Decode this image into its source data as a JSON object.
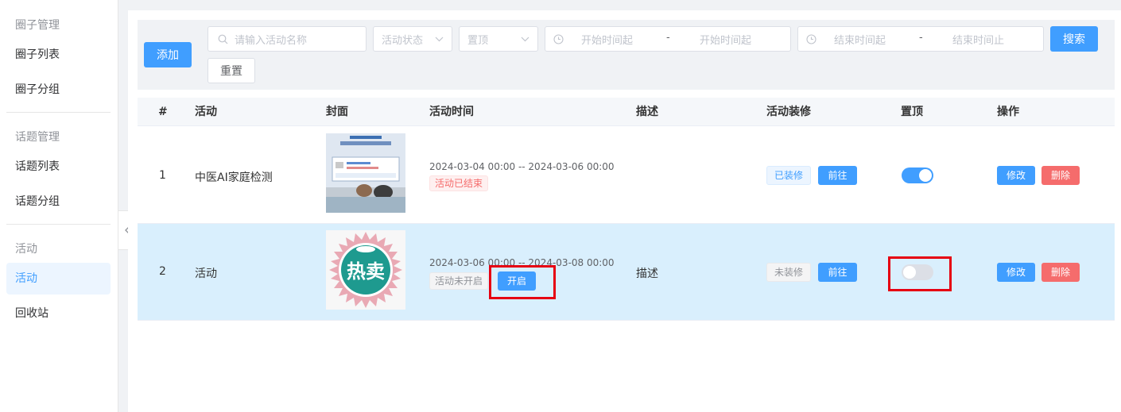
{
  "sidebar": {
    "groups": [
      {
        "title": "圈子管理",
        "items": [
          {
            "label": "圈子列表"
          },
          {
            "label": "圈子分组"
          }
        ]
      },
      {
        "title": "话题管理",
        "items": [
          {
            "label": "话题列表"
          },
          {
            "label": "话题分组"
          }
        ]
      },
      {
        "title": "活动",
        "items": [
          {
            "label": "活动",
            "active": true
          },
          {
            "label": "回收站"
          }
        ]
      }
    ]
  },
  "toolbar": {
    "add_label": "添加",
    "search_placeholder": "请输入活动名称",
    "status_placeholder": "活动状态",
    "pin_placeholder": "置顶",
    "start_range": {
      "from": "开始时间起",
      "sep": "-",
      "to": "开始时间起"
    },
    "end_range": {
      "from": "结束时间起",
      "sep": "-",
      "to": "结束时间止"
    },
    "search_label": "搜索",
    "reset_label": "重置"
  },
  "table": {
    "headers": [
      "#",
      "活动",
      "封面",
      "活动时间",
      "描述",
      "活动装修",
      "置顶",
      "操作"
    ],
    "rows": [
      {
        "index": "1",
        "name": "中医AI家庭检测",
        "time": "2024-03-04 00:00 -- 2024-03-06 00:00",
        "status": "活动已结束",
        "desc": "",
        "decor_status": "已装修",
        "goto_label": "前往",
        "pinned": true,
        "edit_label": "修改",
        "delete_label": "删除"
      },
      {
        "index": "2",
        "name": "活动",
        "time": "2024-03-06 00:00 -- 2024-03-08 00:00",
        "status": "活动未开启",
        "start_label": "开启",
        "desc": "描述",
        "decor_status": "未装修",
        "goto_label": "前往",
        "pinned": false,
        "edit_label": "修改",
        "delete_label": "删除",
        "cover_text": "热卖"
      }
    ]
  },
  "colors": {
    "primary": "#409eff",
    "danger": "#f56c6c",
    "highlight_row": "#d9effd",
    "annotation": "#e60012"
  }
}
